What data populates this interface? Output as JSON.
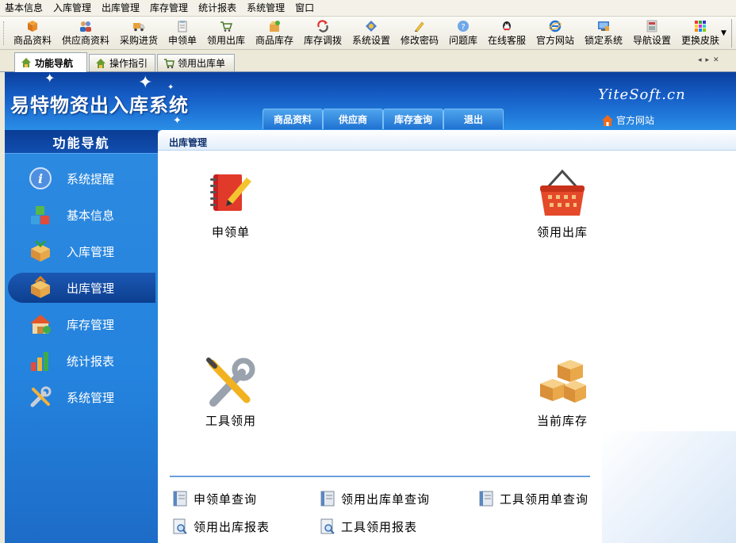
{
  "menu": [
    "基本信息",
    "入库管理",
    "出库管理",
    "库存管理",
    "统计报表",
    "系统管理",
    "窗口"
  ],
  "toolbar": [
    {
      "label": "商品资料",
      "icon": "goods-icon"
    },
    {
      "label": "供应商资料",
      "icon": "supplier-icon"
    },
    {
      "label": "采购进货",
      "icon": "truck-icon"
    },
    {
      "label": "申领单",
      "icon": "request-form-icon"
    },
    {
      "label": "领用出库",
      "icon": "cart-icon"
    },
    {
      "label": "商品库存",
      "icon": "box-icon"
    },
    {
      "label": "库存调拨",
      "icon": "transfer-icon"
    },
    {
      "label": "系统设置",
      "icon": "settings-icon"
    },
    {
      "label": "修改密码",
      "icon": "pencil-icon"
    },
    {
      "label": "问题库",
      "icon": "help-icon"
    },
    {
      "label": "在线客服",
      "icon": "qq-icon"
    },
    {
      "label": "官方网站",
      "icon": "ie-icon"
    },
    {
      "label": "锁定系统",
      "icon": "lock-icon"
    },
    {
      "label": "导航设置",
      "icon": "navigation-icon"
    },
    {
      "label": "更换皮肤",
      "icon": "palette-icon"
    }
  ],
  "tabs": [
    {
      "label": "功能导航",
      "active": true
    },
    {
      "label": "操作指引",
      "active": false
    },
    {
      "label": "领用出库单",
      "active": false
    }
  ],
  "banner": {
    "title": "易特物资出入库系统",
    "brand": "YiteSoft.cn",
    "home_link": "官方网站",
    "nav": [
      "商品资料",
      "供应商",
      "库存查询",
      "退出"
    ]
  },
  "sidebar": {
    "header": "功能导航",
    "items": [
      {
        "label": "系统提醒",
        "icon": "info-icon",
        "active": false
      },
      {
        "label": "基本信息",
        "icon": "cubes-icon",
        "active": false
      },
      {
        "label": "入库管理",
        "icon": "inbound-box-icon",
        "active": false
      },
      {
        "label": "出库管理",
        "icon": "outbound-box-icon",
        "active": true
      },
      {
        "label": "库存管理",
        "icon": "warehouse-icon",
        "active": false
      },
      {
        "label": "统计报表",
        "icon": "bar-chart-icon",
        "active": false
      },
      {
        "label": "系统管理",
        "icon": "tools-icon",
        "active": false
      }
    ]
  },
  "main": {
    "title": "出库管理",
    "functions": [
      {
        "label": "申领单",
        "icon": "notebook-pencil-icon"
      },
      {
        "label": "领用出库",
        "icon": "basket-icon"
      },
      {
        "label": "工具领用",
        "icon": "wrench-screwdriver-icon"
      },
      {
        "label": "当前库存",
        "icon": "stacked-boxes-icon"
      }
    ],
    "queries": [
      {
        "label": "申领单查询",
        "icon": "query-book-icon"
      },
      {
        "label": "领用出库单查询",
        "icon": "query-book-icon"
      },
      {
        "label": "工具领用单查询",
        "icon": "query-book-icon"
      },
      {
        "label": "领用出库报表",
        "icon": "report-magnifier-icon"
      },
      {
        "label": "工具领用报表",
        "icon": "report-magnifier-icon"
      }
    ]
  },
  "colors": {
    "accent": "#1c78d8",
    "banner_dark": "#0b3f9e",
    "sidebar_active": "#0d3f8f"
  }
}
